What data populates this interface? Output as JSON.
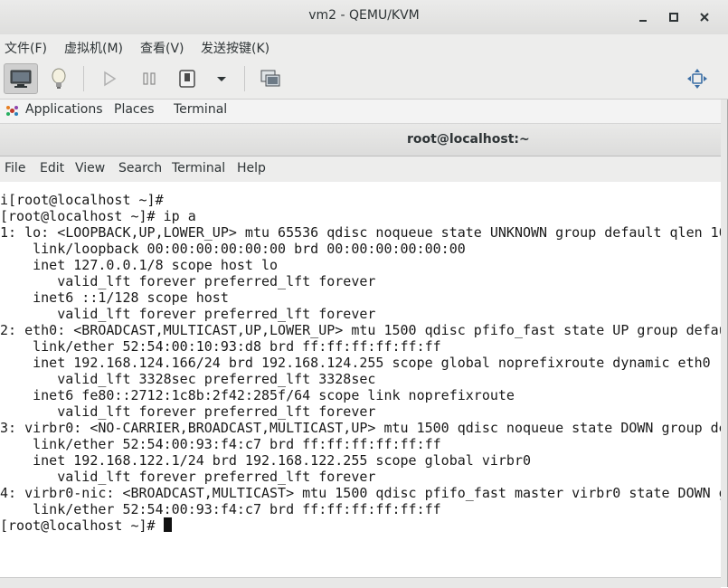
{
  "window": {
    "title": "vm2 - QEMU/KVM",
    "minimize_glyph": "—",
    "maximize_glyph": "□",
    "close_glyph": "✕"
  },
  "menubar": {
    "items": [
      "文件(F)",
      "虚拟机(M)",
      "查看(V)",
      "发送按键(K)"
    ]
  },
  "toolbar": {
    "icons": [
      "monitor-icon",
      "lightbulb-icon",
      "play-icon",
      "pause-icon",
      "power-icon",
      "dropdown-arrow-icon",
      "snapshot-icon",
      "fullscreen-move-icon"
    ]
  },
  "gnome_panel": {
    "applications": "Applications",
    "places": "Places",
    "terminal": "Terminal"
  },
  "terminal_window": {
    "title": "root@localhost:~",
    "menu": [
      "File",
      "Edit",
      "View",
      "Search",
      "Terminal",
      "Help"
    ]
  },
  "terminal_lines": [
    "i[root@localhost ~]#",
    "[root@localhost ~]# ip a",
    "1: lo: <LOOPBACK,UP,LOWER_UP> mtu 65536 qdisc noqueue state UNKNOWN group default qlen 10",
    "    link/loopback 00:00:00:00:00:00 brd 00:00:00:00:00:00",
    "    inet 127.0.0.1/8 scope host lo",
    "       valid_lft forever preferred_lft forever",
    "    inet6 ::1/128 scope host",
    "       valid_lft forever preferred_lft forever",
    "2: eth0: <BROADCAST,MULTICAST,UP,LOWER_UP> mtu 1500 qdisc pfifo_fast state UP group defau",
    "    link/ether 52:54:00:10:93:d8 brd ff:ff:ff:ff:ff:ff",
    "    inet 192.168.124.166/24 brd 192.168.124.255 scope global noprefixroute dynamic eth0",
    "       valid_lft 3328sec preferred_lft 3328sec",
    "    inet6 fe80::2712:1c8b:2f42:285f/64 scope link noprefixroute",
    "       valid_lft forever preferred_lft forever",
    "3: virbr0: <NO-CARRIER,BROADCAST,MULTICAST,UP> mtu 1500 qdisc noqueue state DOWN group de",
    "    link/ether 52:54:00:93:f4:c7 brd ff:ff:ff:ff:ff:ff",
    "    inet 192.168.122.1/24 brd 192.168.122.255 scope global virbr0",
    "       valid_lft forever preferred_lft forever",
    "4: virbr0-nic: <BROADCAST,MULTICAST> mtu 1500 qdisc pfifo_fast master virbr0 state DOWN g",
    "    link/ether 52:54:00:93:f4:c7 brd ff:ff:ff:ff:ff:ff"
  ],
  "prompt": "[root@localhost ~]# "
}
